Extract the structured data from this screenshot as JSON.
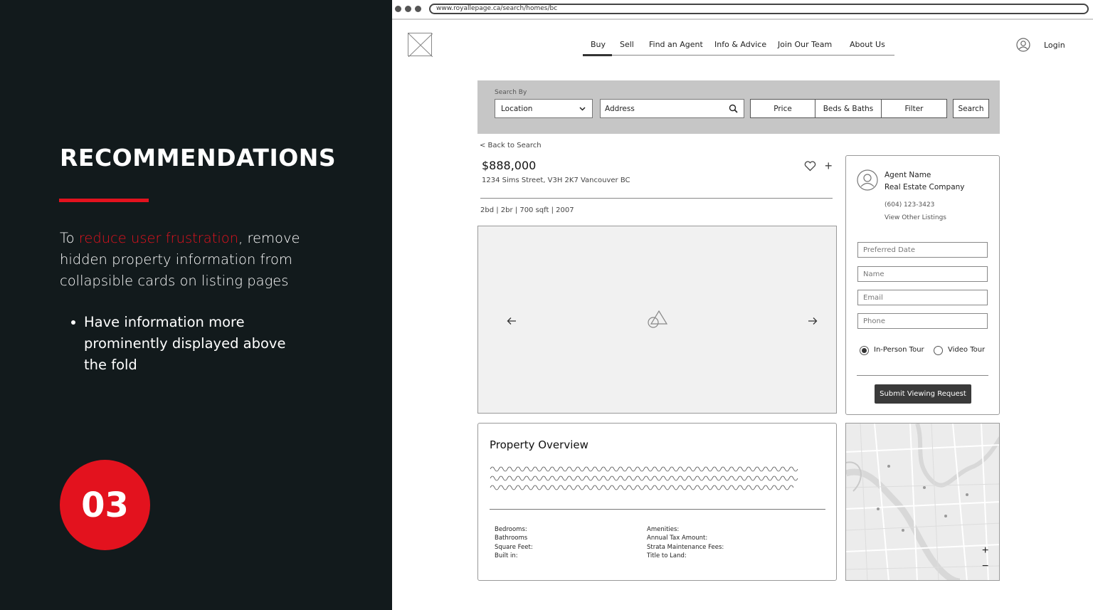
{
  "slide": {
    "title": "RECOMMENDATIONS",
    "body_prefix": "To ",
    "body_highlight": "reduce user frustration",
    "body_rest": ", remove hidden property information from collapsible cards on listing pages",
    "bullet": "Have information more prominently displayed above the fold",
    "step_number": "03",
    "accent_color": "#e3121e",
    "bg_color": "#121a1c"
  },
  "browser": {
    "url": "www.royallepage.ca/search/homes/bc"
  },
  "nav": {
    "items": [
      "Buy",
      "Sell",
      "Find an Agent",
      "Info & Advice",
      "Join Our Team",
      "About Us"
    ],
    "active": "Buy",
    "login": "Login"
  },
  "search": {
    "label": "Search By",
    "location": "Location",
    "address_placeholder": "Address",
    "price": "Price",
    "beds_baths": "Beds & Baths",
    "filter": "Filter",
    "search_button": "Search"
  },
  "listing": {
    "back": "< Back to Search",
    "price": "$888,000",
    "address": "1234 Sims Street, V3H 2K7 Vancouver BC",
    "specs": "2bd | 2br | 700 sqft | 2007"
  },
  "agent": {
    "name": "Agent Name",
    "company": "Real Estate Company",
    "phone": "(604) 123-3423",
    "other_listings": "View Other Listings",
    "fields": [
      "Preferred Date",
      "Name",
      "Email",
      "Phone"
    ],
    "tour_options": [
      "In-Person Tour",
      "Video Tour"
    ],
    "selected_tour": "In-Person Tour",
    "submit": "Submit Viewing Request"
  },
  "overview": {
    "title": "Property Overview",
    "left_details": [
      "Bedrooms:",
      "Bathrooms",
      "Square Feet:",
      "Built in:"
    ],
    "right_details": [
      "Amenities:",
      "Annual Tax Amount:",
      "Strata Maintenance Fees:",
      "Title to Land:"
    ]
  },
  "map": {
    "zoom_in": "+",
    "zoom_out": "−"
  }
}
